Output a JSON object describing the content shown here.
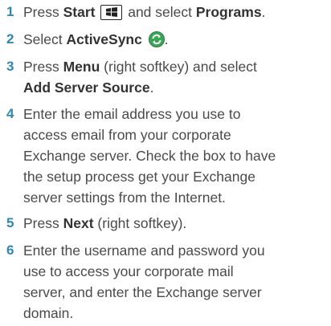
{
  "steps": [
    {
      "num": "1",
      "parts": [
        "Press ",
        "Start",
        " and select ",
        "Programs",
        "."
      ]
    },
    {
      "num": "2",
      "parts": [
        "Select ",
        "ActiveSync",
        "."
      ]
    },
    {
      "num": "3",
      "parts": [
        "Press ",
        "Menu",
        " (right softkey) and select",
        "Add Server Source",
        "."
      ]
    },
    {
      "num": "4",
      "lines": [
        "Enter the email address you use to",
        "access email from your corporate",
        "Exchange server. Check the box to have",
        "the setup process get your Exchange",
        "server settings from the Internet."
      ]
    },
    {
      "num": "5",
      "parts": [
        "Press ",
        "Next",
        " (right softkey)."
      ]
    },
    {
      "num": "6",
      "lines": [
        "Enter the username and password you",
        "use to access your corporate mail",
        "server, and enter the Exchange server",
        "domain."
      ]
    }
  ],
  "icons": {
    "start": "windows-start-key-icon",
    "activesync": "activesync-icon"
  },
  "colors": {
    "number": "#2f86b3",
    "text": "#4a4a4a",
    "sync_green": "#3aa655"
  }
}
